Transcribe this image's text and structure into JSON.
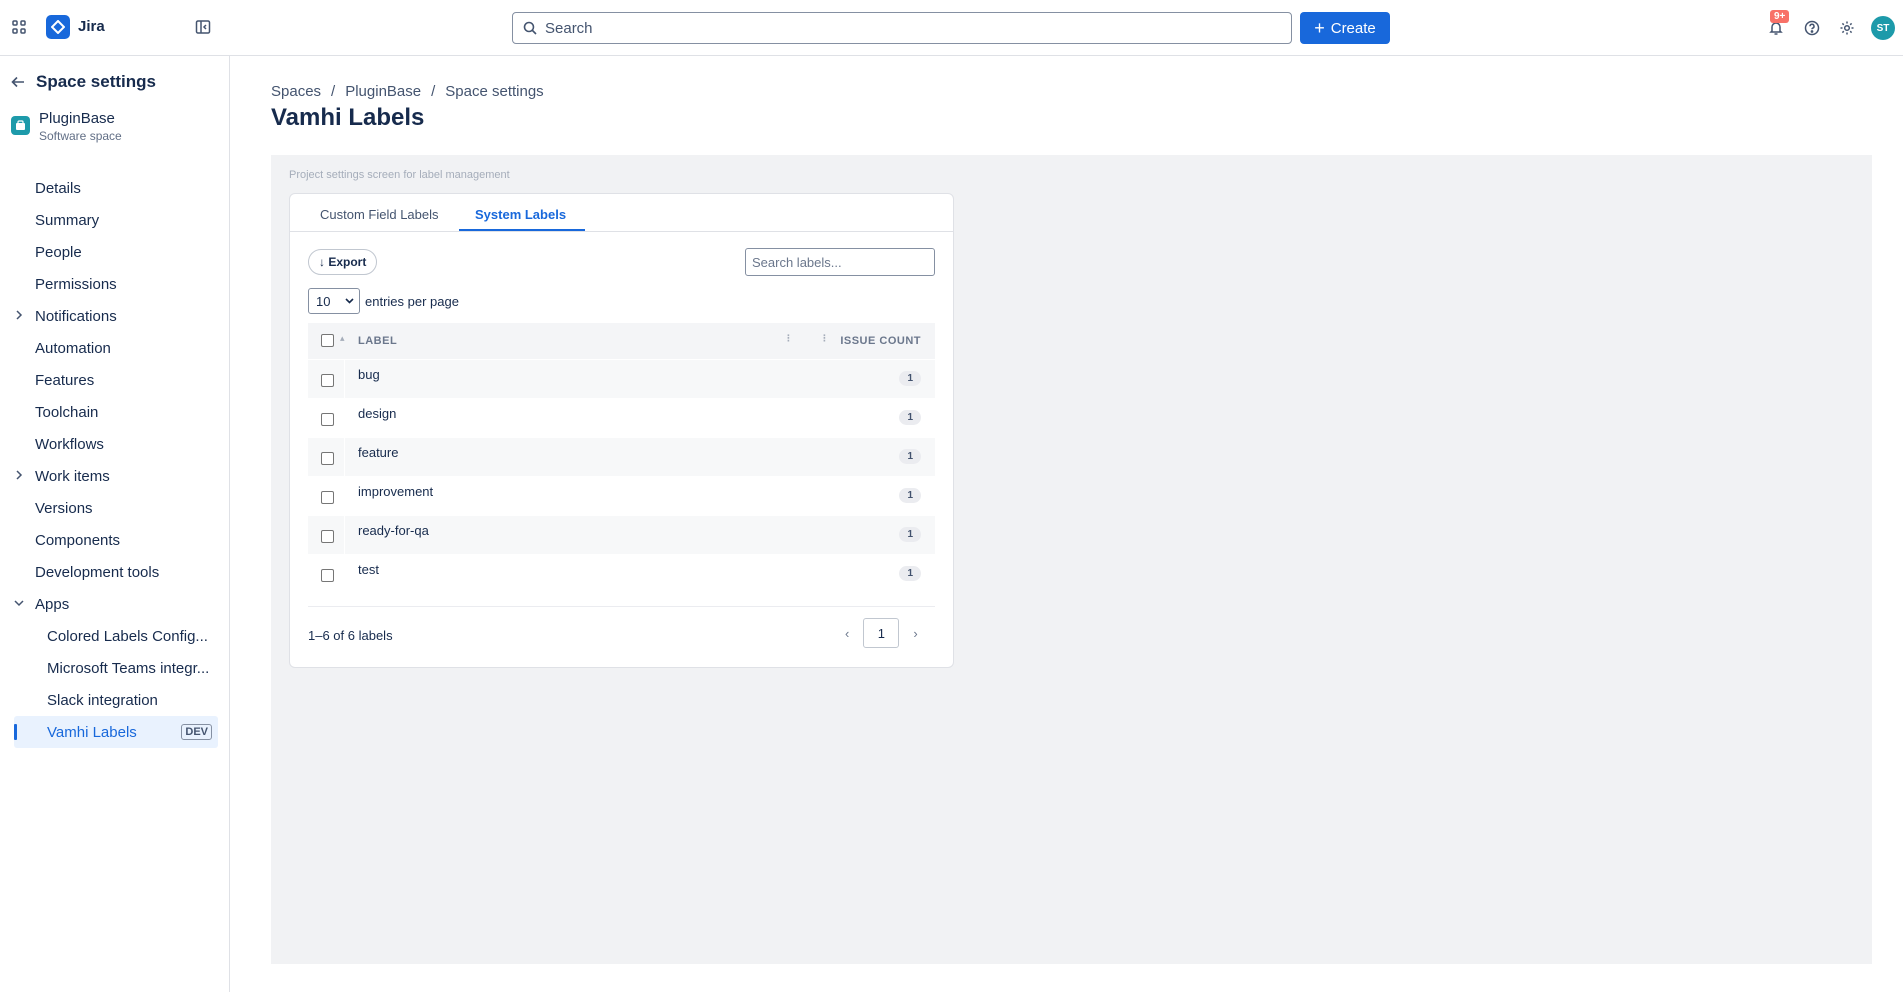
{
  "app": {
    "brand": "Jira"
  },
  "topbar": {
    "search_placeholder": "Search",
    "create_label": "Create",
    "notifications_badge": "9+",
    "avatar_initials": "ST"
  },
  "sidebar": {
    "title": "Space settings",
    "project": {
      "name": "PluginBase",
      "type": "Software space"
    },
    "items": [
      {
        "label": "Details"
      },
      {
        "label": "Summary"
      },
      {
        "label": "People"
      },
      {
        "label": "Permissions"
      },
      {
        "label": "Notifications"
      },
      {
        "label": "Automation"
      },
      {
        "label": "Features"
      },
      {
        "label": "Toolchain"
      },
      {
        "label": "Workflows"
      },
      {
        "label": "Work items"
      },
      {
        "label": "Versions"
      },
      {
        "label": "Components"
      },
      {
        "label": "Development tools"
      },
      {
        "label": "Apps"
      }
    ],
    "apps": [
      {
        "label": "Colored Labels Config..."
      },
      {
        "label": "Microsoft Teams integr..."
      },
      {
        "label": "Slack integration"
      },
      {
        "label": "Vamhi Labels",
        "tag": "DEV"
      }
    ]
  },
  "breadcrumb": [
    "Spaces",
    "/",
    "PluginBase",
    "/",
    "Space settings"
  ],
  "page": {
    "title": "Vamhi Labels",
    "caption": "Project settings screen for label management"
  },
  "labels_panel": {
    "tabs": [
      "Custom Field Labels",
      "System Labels"
    ],
    "export_label": "↓ Export",
    "search_placeholder": "Search labels...",
    "page_size": "10",
    "entries_suffix": "entries per page",
    "columns": {
      "label": "LABEL",
      "count": "ISSUE COUNT"
    },
    "rows": [
      {
        "label": "bug",
        "count": "1"
      },
      {
        "label": "design",
        "count": "1"
      },
      {
        "label": "feature",
        "count": "1"
      },
      {
        "label": "improvement",
        "count": "1"
      },
      {
        "label": "ready-for-qa",
        "count": "1"
      },
      {
        "label": "test",
        "count": "1"
      }
    ],
    "range_text": "1–6 of 6 labels",
    "current_page": "1"
  }
}
